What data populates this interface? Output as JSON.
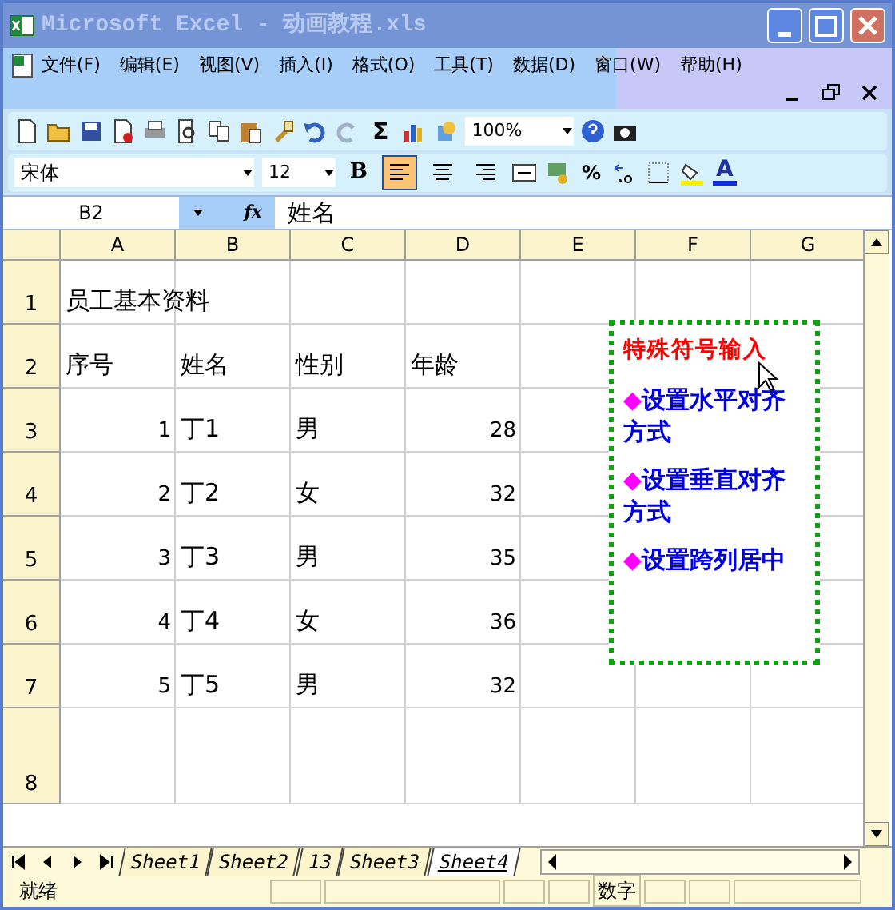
{
  "window": {
    "title": "Microsoft Excel - 动画教程.xls"
  },
  "menu": [
    "文件(F)",
    "编辑(E)",
    "视图(V)",
    "插入(I)",
    "格式(O)",
    "工具(T)",
    "数据(D)",
    "窗口(W)",
    "帮助(H)"
  ],
  "standard_toolbar": {
    "sum": "Σ",
    "zoom": "100%"
  },
  "formatting_toolbar": {
    "font": "宋体",
    "size": "12",
    "bold": "B",
    "percent": "%",
    "font_color": "A",
    "alignment": [
      {
        "selected": true
      },
      {
        "selected": false
      },
      {
        "selected": false
      }
    ]
  },
  "formula_bar": {
    "name_box": "B2",
    "fx": "fx",
    "value": "姓名"
  },
  "columns": [
    "A",
    "B",
    "C",
    "D",
    "E",
    "F",
    "G"
  ],
  "rows": [
    {
      "number": "1",
      "cells": {
        "A": {
          "text": "员工基本资料",
          "kind": "text"
        }
      }
    },
    {
      "number": "2",
      "cells": {
        "A": {
          "text": "序号",
          "kind": "text"
        },
        "B": {
          "text": "姓名",
          "kind": "text"
        },
        "C": {
          "text": "性别",
          "kind": "text"
        },
        "D": {
          "text": "年龄",
          "kind": "text"
        }
      }
    },
    {
      "number": "3",
      "cells": {
        "A": {
          "text": "1",
          "kind": "number"
        },
        "B": {
          "text": "丁1",
          "kind": "text"
        },
        "C": {
          "text": "男",
          "kind": "text"
        },
        "D": {
          "text": "28",
          "kind": "number"
        }
      }
    },
    {
      "number": "4",
      "cells": {
        "A": {
          "text": "2",
          "kind": "number"
        },
        "B": {
          "text": "丁2",
          "kind": "text"
        },
        "C": {
          "text": "女",
          "kind": "text"
        },
        "D": {
          "text": "32",
          "kind": "number"
        }
      }
    },
    {
      "number": "5",
      "cells": {
        "A": {
          "text": "3",
          "kind": "number"
        },
        "B": {
          "text": "丁3",
          "kind": "text"
        },
        "C": {
          "text": "男",
          "kind": "text"
        },
        "D": {
          "text": "35",
          "kind": "number"
        }
      }
    },
    {
      "number": "6",
      "cells": {
        "A": {
          "text": "4",
          "kind": "number"
        },
        "B": {
          "text": "丁4",
          "kind": "text"
        },
        "C": {
          "text": "女",
          "kind": "text"
        },
        "D": {
          "text": "36",
          "kind": "number"
        }
      }
    },
    {
      "number": "7",
      "cells": {
        "A": {
          "text": "5",
          "kind": "number"
        },
        "B": {
          "text": "丁5",
          "kind": "text"
        },
        "C": {
          "text": "男",
          "kind": "text"
        },
        "D": {
          "text": "32",
          "kind": "number"
        }
      }
    },
    {
      "number": "8"
    }
  ],
  "text_box": {
    "title": "特殊符号输入",
    "items": [
      {
        "bullet": "◆",
        "text": "设置水平对齐方式"
      },
      {
        "bullet": "◆",
        "text": "设置垂直对齐方式"
      },
      {
        "bullet": "◆",
        "text": "设置跨列居中"
      }
    ]
  },
  "sheet_tabs": [
    {
      "label": "Sheet1",
      "selected": false
    },
    {
      "label": "Sheet2",
      "selected": false
    },
    {
      "label": "13",
      "selected": false
    },
    {
      "label": "Sheet3",
      "selected": false
    },
    {
      "label": "Sheet4",
      "selected": true
    }
  ],
  "status_bar": {
    "left": "就绪",
    "mode": "数字"
  }
}
